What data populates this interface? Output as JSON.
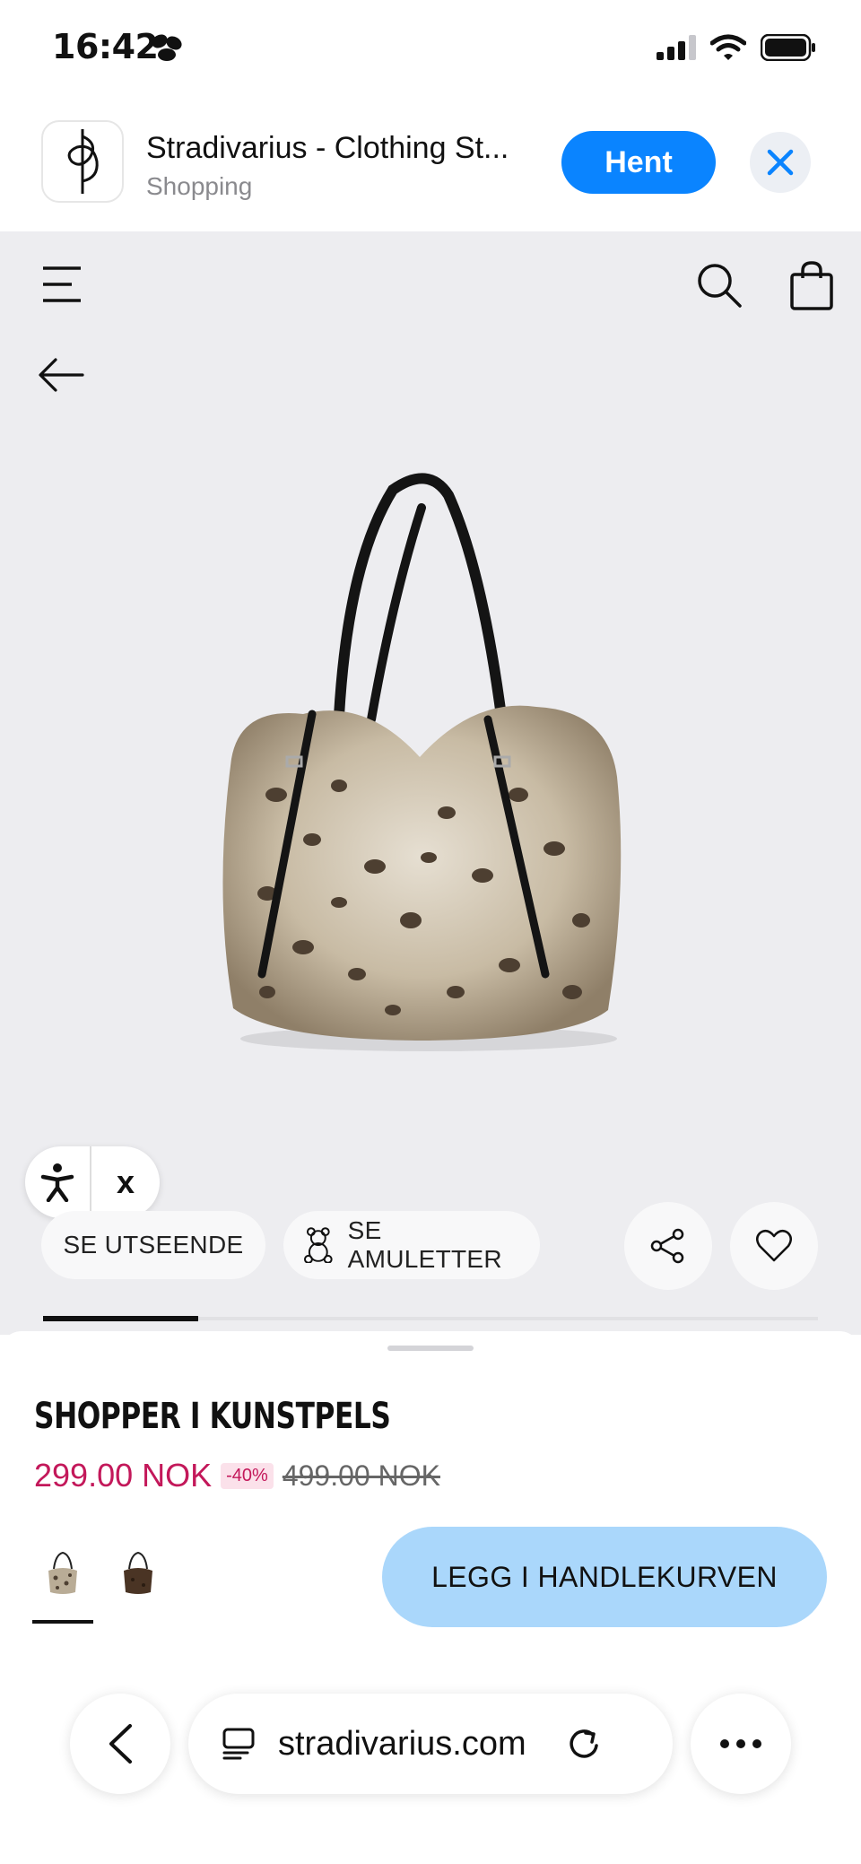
{
  "status_bar": {
    "time": "16:42",
    "signal_icon": "cellular-signal-icon",
    "wifi_icon": "wifi-icon",
    "battery_icon": "battery-icon"
  },
  "app_banner": {
    "title": "Stradivarius - Clothing St...",
    "category": "Shopping",
    "get_label": "Hent",
    "icon": "stradivarius-logo-icon",
    "accent_color": "#0a84ff"
  },
  "header": {
    "menu_icon": "menu-icon",
    "search_icon": "search-icon",
    "bag_icon": "shopping-bag-icon",
    "back_icon": "back-arrow-icon"
  },
  "gallery": {
    "image_label": "faux fur leopard shopper bag",
    "progress_fraction": 0.2
  },
  "accessibility": {
    "icon": "accessibility-icon",
    "close_label": "x"
  },
  "actions": {
    "look_label": "SE UTSEENDE",
    "amulet_label": "SE AMULETTER",
    "amulet_icon": "teddy-bear-icon",
    "share_icon": "share-icon",
    "favorite_icon": "heart-icon"
  },
  "product": {
    "title": "SHOPPER I KUNSTPELS",
    "price_now": "299.00 NOK",
    "discount": "-40%",
    "price_old": "499.00 NOK",
    "sale_color": "#c3185a",
    "colors": [
      {
        "name": "leopard-swatch",
        "selected": true
      },
      {
        "name": "brown-swatch",
        "selected": false
      }
    ],
    "add_to_cart_label": "LEGG I HANDLEKURVEN",
    "cart_button_color": "#aad7fb"
  },
  "browser": {
    "url": "stradivarius.com",
    "back_icon": "chevron-left-icon",
    "tabs_icon": "reader-icon",
    "reload_icon": "reload-icon",
    "more_icon": "more-icon"
  }
}
